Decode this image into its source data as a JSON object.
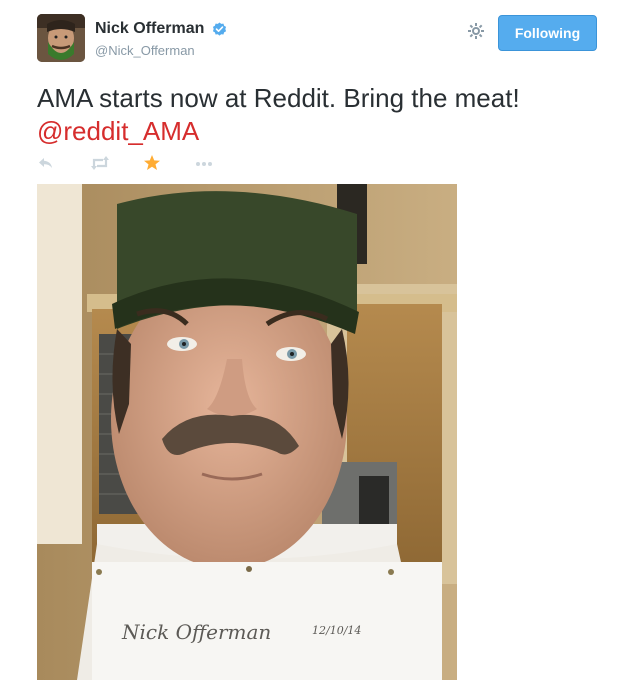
{
  "tweet": {
    "author": {
      "display_name": "Nick Offerman",
      "handle": "@Nick_Offerman",
      "verified": true
    },
    "text_main": "AMA starts now at Reddit. Bring the meat!",
    "mention": "@reddit_AMA",
    "follow_button_label": "Following",
    "actions": [
      {
        "name": "reply-icon"
      },
      {
        "name": "retweet-icon"
      },
      {
        "name": "favorite-icon",
        "state": "active"
      },
      {
        "name": "more-icon"
      }
    ],
    "photo": {
      "subject": "selfie with green cap and mustache holding signed paper",
      "paper_signature": "Nick Offerman",
      "paper_date": "12/10/14"
    }
  },
  "colors": {
    "follow_button_bg": "#55acee",
    "mention": "#d62d2d",
    "favorite_active": "#ffac33",
    "action_inactive": "#ccd6dd",
    "handle": "#8899a6"
  }
}
